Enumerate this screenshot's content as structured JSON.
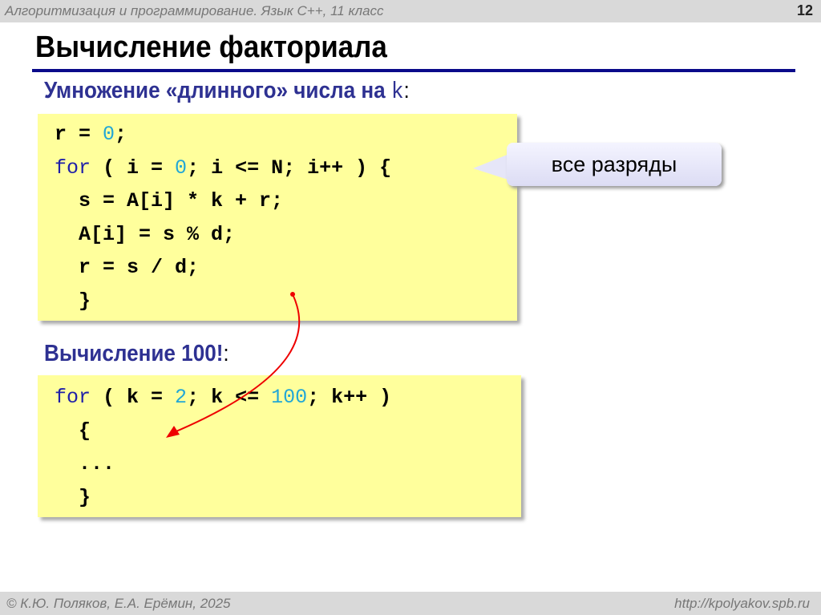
{
  "header": {
    "course": "Алгоритмизация и программирование. Язык C++, 11 класс",
    "slide_number": "12"
  },
  "title": "Вычисление факториала",
  "subtitle": {
    "text": "Умножение «длинного» числа на ",
    "var": "k",
    "colon": ":"
  },
  "code1": [
    [
      {
        "t": "r = "
      },
      {
        "t": "0",
        "c": "num"
      },
      {
        "t": ";"
      }
    ],
    [
      {
        "t": "for",
        "c": "kw"
      },
      {
        "t": " ( i = "
      },
      {
        "t": "0",
        "c": "num"
      },
      {
        "t": "; i <= N; i++ ) {"
      }
    ],
    [
      {
        "t": "  s = A[i] * k + r;"
      }
    ],
    [
      {
        "t": "  A[i] = s % d;"
      }
    ],
    [
      {
        "t": "  r = s / d;"
      }
    ],
    [
      {
        "t": "  }"
      }
    ]
  ],
  "callout": "все разряды",
  "subtitle2": {
    "text": "Вычисление 100!",
    "colon": ":"
  },
  "code2": [
    [
      {
        "t": "for",
        "c": "kw"
      },
      {
        "t": " ( k = "
      },
      {
        "t": "2",
        "c": "num"
      },
      {
        "t": "; k <= "
      },
      {
        "t": "100",
        "c": "num"
      },
      {
        "t": "; k++ )"
      }
    ],
    [
      {
        "t": "  {"
      }
    ],
    [
      {
        "t": "  ..."
      }
    ],
    [
      {
        "t": "  }"
      }
    ]
  ],
  "footer": {
    "authors": "© К.Ю. Поляков, Е.А. Ерёмин, 2025",
    "url": "http://kpolyakov.spb.ru"
  }
}
